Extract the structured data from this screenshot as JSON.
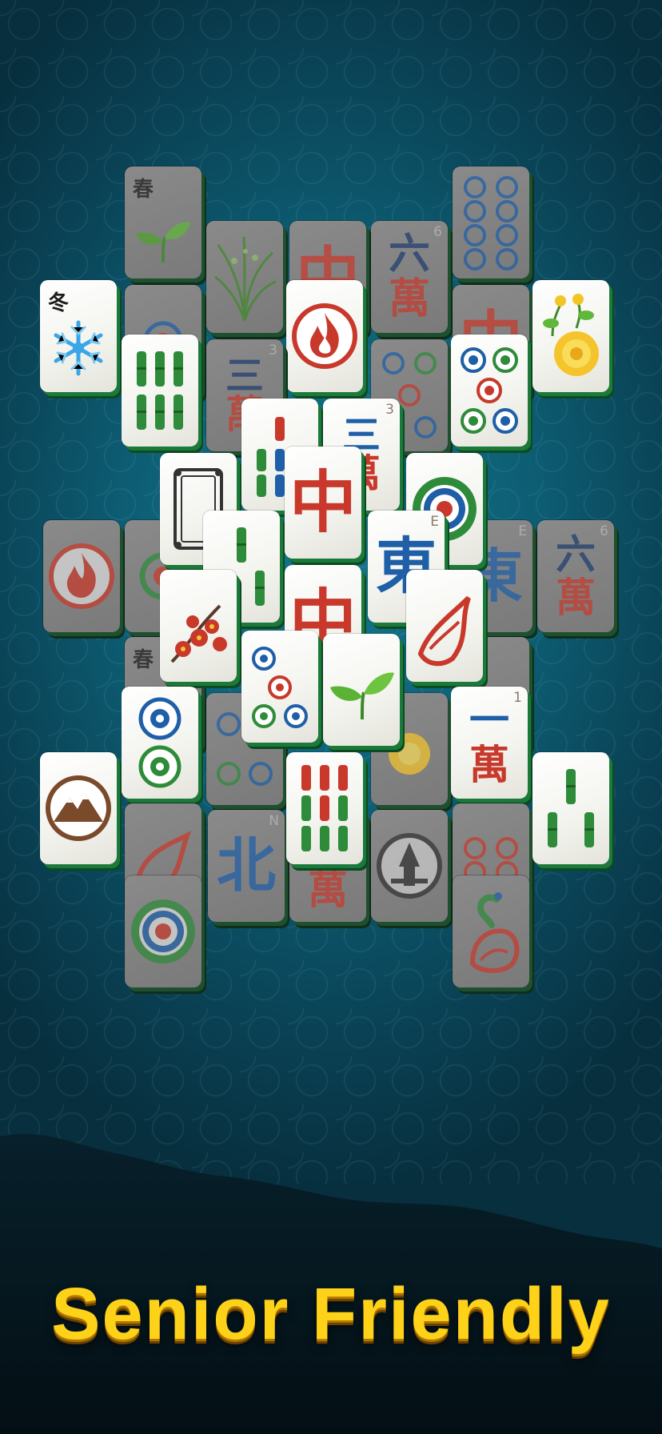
{
  "tagline": "Senior Friendly",
  "colors": {
    "accent": "#ffd21a",
    "background": "#0d5d73",
    "red": "#c8392b",
    "green": "#2e8b3a",
    "blue": "#1e5fa8"
  },
  "tiles": {
    "spring_top": {
      "text": "春",
      "icon": "leaf-sprout-icon"
    },
    "winter": {
      "text": "冬",
      "icon": "snowflake-icon"
    },
    "bamboo6_left": {
      "icon": "bamboo-icon",
      "count": 6
    },
    "orchid": {
      "icon": "orchid-icon"
    },
    "red_dragon_dim": {
      "text": "中"
    },
    "fire_flower": {
      "icon": "fire-flower-icon"
    },
    "six_wan_top": {
      "num": "6",
      "text1": "六",
      "text2": "萬"
    },
    "circles_dim": {
      "icon": "circle-dots-icon"
    },
    "chrysanthemum_right": {
      "icon": "chrysanthemum-icon"
    },
    "three_wan": {
      "num": "3",
      "text1": "三",
      "text2": "萬"
    },
    "circles5": {
      "icon": "circle-dots-icon",
      "count": 5
    },
    "bamboo_center_left": {
      "icon": "bamboo-icon"
    },
    "three_wan_center": {
      "num": "3",
      "text1": "三",
      "text2": "萬"
    },
    "white_dragon": {
      "icon": "frame-icon"
    },
    "bamboo3": {
      "icon": "bamboo-icon",
      "count": 3
    },
    "red_dragon_top": {
      "text": "中"
    },
    "big_circle": {
      "icon": "circle-dots-icon"
    },
    "east": {
      "num": "E",
      "text": "東"
    },
    "red_dragon_front": {
      "text": "中"
    },
    "fire_left": {
      "icon": "fire-flower-icon"
    },
    "six_wan_right": {
      "num": "6",
      "text1": "六",
      "text2": "萬"
    },
    "east_dim": {
      "num": "E",
      "text": "東"
    },
    "plum": {
      "icon": "plum-blossom-icon"
    },
    "spring_mid": {
      "text": "春"
    },
    "circles2": {
      "icon": "circle-dots-icon",
      "count": 2
    },
    "circles4": {
      "icon": "circle-dots-icon",
      "count": 4
    },
    "sprout": {
      "icon": "leaf-sprout-icon"
    },
    "one_wan": {
      "num": "1",
      "text1": "一",
      "text2": "萬"
    },
    "mountain": {
      "icon": "mountain-icon"
    },
    "bamboo9": {
      "icon": "bamboo-icon",
      "count": 9
    },
    "bamboo3_right": {
      "icon": "bamboo-icon",
      "count": 3
    },
    "north": {
      "num": "N",
      "text": "北"
    },
    "wan_dim": {
      "text": "萬"
    },
    "sword": {
      "icon": "sword-emblem-icon"
    },
    "phoenix": {
      "icon": "phoenix-icon"
    },
    "big_circle_bottom": {
      "icon": "circle-dots-icon"
    }
  }
}
